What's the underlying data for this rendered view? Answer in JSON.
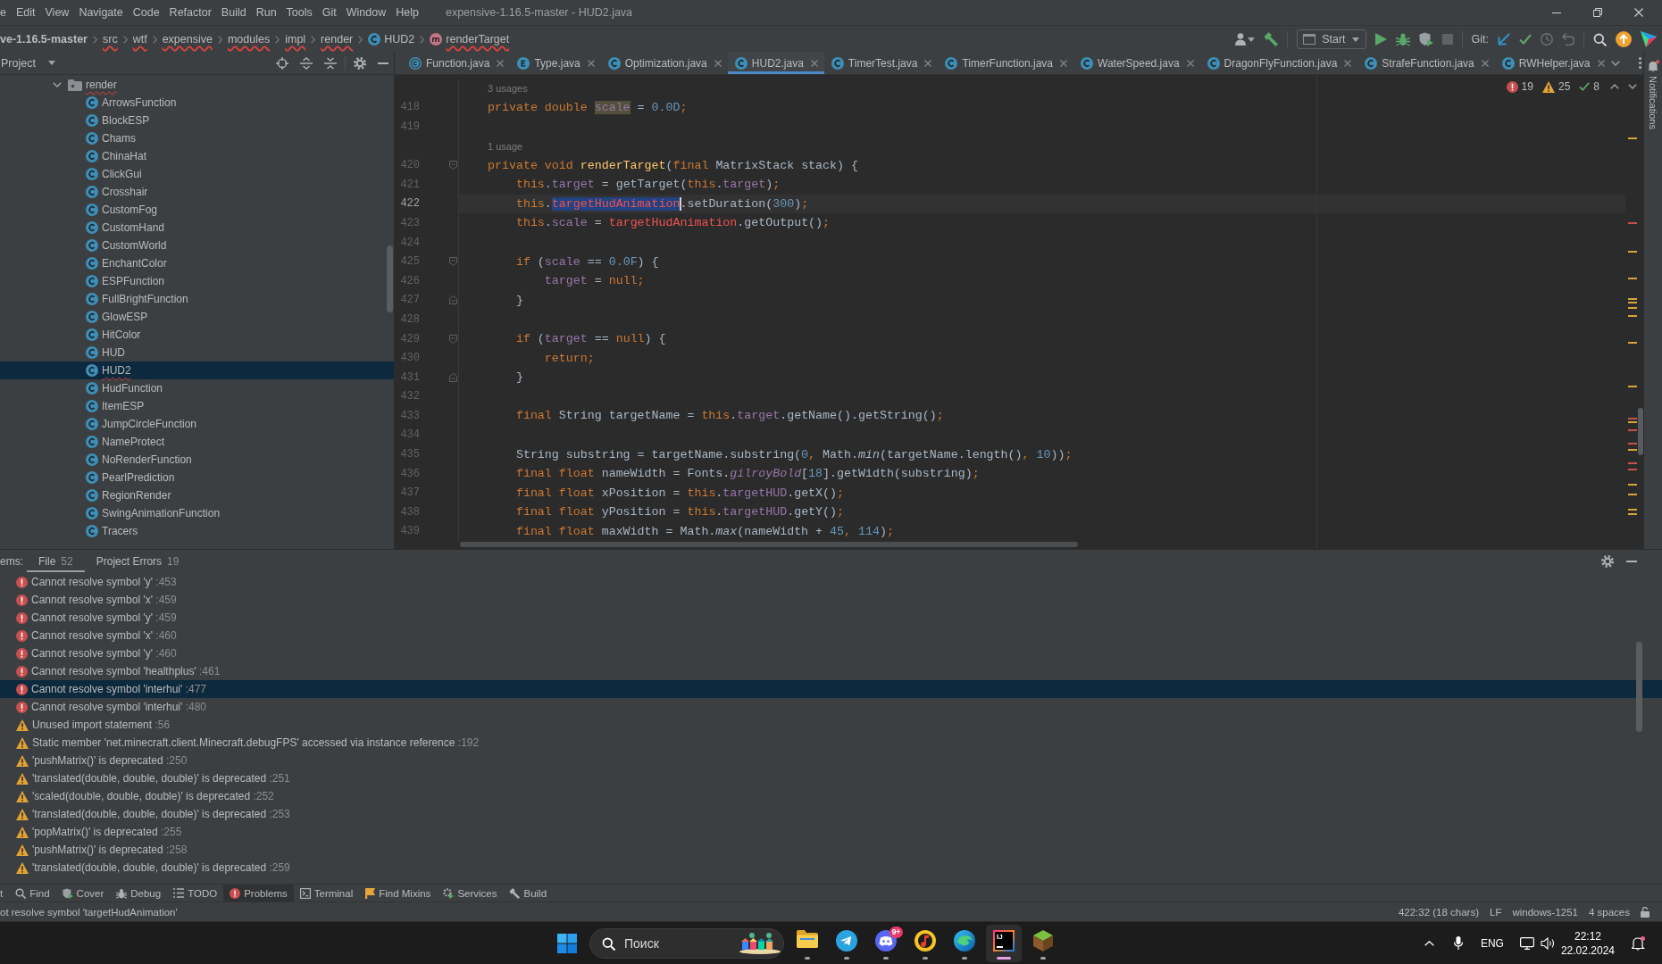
{
  "menu_bar": {
    "items": [
      "e",
      "Edit",
      "View",
      "Navigate",
      "Code",
      "Refactor",
      "Build",
      "Run",
      "Tools",
      "Git",
      "Window",
      "Help"
    ],
    "title": "expensive-1.16.5-master - HUD2.java"
  },
  "navigation_bar": {
    "breadcrumbs": [
      {
        "label": "ve-1.16.5-master",
        "kind": "project",
        "has_error": false
      },
      {
        "label": "src",
        "kind": "folder",
        "has_error": true
      },
      {
        "label": "wtf",
        "kind": "folder",
        "has_error": true
      },
      {
        "label": "expensive",
        "kind": "folder",
        "has_error": true
      },
      {
        "label": "modules",
        "kind": "folder",
        "has_error": true
      },
      {
        "label": "impl",
        "kind": "folder",
        "has_error": true
      },
      {
        "label": "render",
        "kind": "folder",
        "has_error": true
      },
      {
        "label": "HUD2",
        "kind": "class",
        "has_error": false
      },
      {
        "label": "renderTarget",
        "kind": "method",
        "has_error": true
      }
    ],
    "run_configuration": "Start",
    "vcs_label": "Git:"
  },
  "project_panel": {
    "title": "Project",
    "tree": [
      {
        "label": "render",
        "kind": "folder",
        "expanded": true,
        "selected": false,
        "has_error": true,
        "children": [
          {
            "label": "ArrowsFunction",
            "kind": "class",
            "selected": false,
            "has_error": false
          },
          {
            "label": "BlockESP",
            "kind": "class",
            "selected": false,
            "has_error": false
          },
          {
            "label": "Chams",
            "kind": "class",
            "selected": false,
            "has_error": false
          },
          {
            "label": "ChinaHat",
            "kind": "class",
            "selected": false,
            "has_error": false
          },
          {
            "label": "ClickGui",
            "kind": "class",
            "selected": false,
            "has_error": false
          },
          {
            "label": "Crosshair",
            "kind": "class",
            "selected": false,
            "has_error": false
          },
          {
            "label": "CustomFog",
            "kind": "class",
            "selected": false,
            "has_error": false
          },
          {
            "label": "CustomHand",
            "kind": "class",
            "selected": false,
            "has_error": false
          },
          {
            "label": "CustomWorld",
            "kind": "class",
            "selected": false,
            "has_error": false
          },
          {
            "label": "EnchantColor",
            "kind": "class",
            "selected": false,
            "has_error": false
          },
          {
            "label": "ESPFunction",
            "kind": "class",
            "selected": false,
            "has_error": false
          },
          {
            "label": "FullBrightFunction",
            "kind": "class",
            "selected": false,
            "has_error": false
          },
          {
            "label": "GlowESP",
            "kind": "class",
            "selected": false,
            "has_error": false
          },
          {
            "label": "HitColor",
            "kind": "class",
            "selected": false,
            "has_error": false
          },
          {
            "label": "HUD",
            "kind": "class",
            "selected": false,
            "has_error": false
          },
          {
            "label": "HUD2",
            "kind": "class",
            "selected": true,
            "has_error": true
          },
          {
            "label": "HudFunction",
            "kind": "class",
            "selected": false,
            "has_error": false
          },
          {
            "label": "ItemESP",
            "kind": "class",
            "selected": false,
            "has_error": false
          },
          {
            "label": "JumpCircleFunction",
            "kind": "class",
            "selected": false,
            "has_error": false
          },
          {
            "label": "NameProtect",
            "kind": "class",
            "selected": false,
            "has_error": false
          },
          {
            "label": "NoRenderFunction",
            "kind": "class",
            "selected": false,
            "has_error": false
          },
          {
            "label": "PearlPrediction",
            "kind": "class",
            "selected": false,
            "has_error": false
          },
          {
            "label": "RegionRender",
            "kind": "class",
            "selected": false,
            "has_error": false
          },
          {
            "label": "SwingAnimationFunction",
            "kind": "class",
            "selected": false,
            "has_error": false
          },
          {
            "label": "Tracers",
            "kind": "class",
            "selected": false,
            "has_error": false
          }
        ]
      }
    ]
  },
  "editor_tabs": [
    {
      "label": "Function.java",
      "kind": "abstract-class",
      "selected": false
    },
    {
      "label": "Type.java",
      "kind": "enum",
      "selected": false
    },
    {
      "label": "Optimization.java",
      "kind": "class",
      "selected": false
    },
    {
      "label": "HUD2.java",
      "kind": "class",
      "selected": true
    },
    {
      "label": "TimerTest.java",
      "kind": "class",
      "selected": false
    },
    {
      "label": "TimerFunction.java",
      "kind": "class",
      "selected": false
    },
    {
      "label": "WaterSpeed.java",
      "kind": "class",
      "selected": false
    },
    {
      "label": "DragonFlyFunction.java",
      "kind": "class",
      "selected": false
    },
    {
      "label": "StrafeFunction.java",
      "kind": "class",
      "selected": false
    },
    {
      "label": "RWHelper.java",
      "kind": "class",
      "selected": false
    }
  ],
  "editor": {
    "inspections": {
      "errors": "19",
      "warnings": "25",
      "weak_warnings": "8"
    },
    "lines": [
      {
        "kind": "hint",
        "text": "3 usages"
      },
      {
        "kind": "code",
        "number": "418",
        "current": false,
        "tokens": [
          {
            "text": "private double ",
            "kind": "keyword"
          },
          {
            "text": "scale",
            "kind": "field",
            "highlighted": true
          },
          {
            "text": " = ",
            "kind": "plain"
          },
          {
            "text": "0.0D",
            "kind": "number"
          },
          {
            "text": ";",
            "kind": "keyword"
          }
        ]
      },
      {
        "kind": "code",
        "number": "419",
        "current": false
      },
      {
        "kind": "hint",
        "text": "1 usage"
      },
      {
        "kind": "fold-start",
        "number": "420",
        "current": false,
        "tokens": [
          {
            "text": "private void ",
            "kind": "keyword"
          },
          {
            "text": "renderTarget",
            "kind": "declaration"
          },
          {
            "text": "(",
            "kind": "plain"
          },
          {
            "text": "final ",
            "kind": "keyword"
          },
          {
            "text": "MatrixStack stack) {",
            "kind": "plain"
          }
        ]
      },
      {
        "kind": "code",
        "number": "421",
        "current": false,
        "tokens": [
          {
            "text": "    this",
            "kind": "keyword"
          },
          {
            "text": ".",
            "kind": "plain"
          },
          {
            "text": "target",
            "kind": "field"
          },
          {
            "text": " = getTarget(",
            "kind": "plain"
          },
          {
            "text": "this",
            "kind": "keyword"
          },
          {
            "text": ".",
            "kind": "plain"
          },
          {
            "text": "target",
            "kind": "field"
          },
          {
            "text": ")",
            "kind": "plain"
          },
          {
            "text": ";",
            "kind": "keyword"
          }
        ]
      },
      {
        "kind": "code",
        "number": "422",
        "current": true,
        "tokens": [
          {
            "text": "    this",
            "kind": "keyword"
          },
          {
            "text": ".",
            "kind": "plain"
          },
          {
            "text": "targetHudAnimation",
            "kind": "unresolved",
            "selected": true
          },
          {
            "text": ".setDuration(",
            "kind": "plain"
          },
          {
            "text": "300",
            "kind": "number"
          },
          {
            "text": ")",
            "kind": "plain"
          },
          {
            "text": ";",
            "kind": "keyword"
          }
        ]
      },
      {
        "kind": "code",
        "number": "423",
        "current": false,
        "tokens": [
          {
            "text": "    this",
            "kind": "keyword"
          },
          {
            "text": ".",
            "kind": "plain"
          },
          {
            "text": "scale",
            "kind": "field"
          },
          {
            "text": " = ",
            "kind": "plain"
          },
          {
            "text": "targetHudAnimation",
            "kind": "unresolved"
          },
          {
            "text": ".getOutput()",
            "kind": "plain"
          },
          {
            "text": ";",
            "kind": "keyword"
          }
        ]
      },
      {
        "kind": "code",
        "number": "424",
        "current": false
      },
      {
        "kind": "fold-start",
        "number": "425",
        "current": false,
        "tokens": [
          {
            "text": "    if",
            "kind": "keyword"
          },
          {
            "text": " (",
            "kind": "plain"
          },
          {
            "text": "scale",
            "kind": "field"
          },
          {
            "text": " == ",
            "kind": "plain"
          },
          {
            "text": "0.0F",
            "kind": "number"
          },
          {
            "text": ") {",
            "kind": "plain"
          }
        ]
      },
      {
        "kind": "code",
        "number": "426",
        "current": false,
        "tokens": [
          {
            "text": "        target",
            "kind": "field"
          },
          {
            "text": " = ",
            "kind": "plain"
          },
          {
            "text": "null;",
            "kind": "keyword"
          }
        ]
      },
      {
        "kind": "fold-end",
        "number": "427",
        "current": false,
        "tokens": [
          {
            "text": "    }",
            "kind": "plain"
          }
        ]
      },
      {
        "kind": "code",
        "number": "428",
        "current": false
      },
      {
        "kind": "fold-start",
        "number": "429",
        "current": false,
        "tokens": [
          {
            "text": "    if",
            "kind": "keyword"
          },
          {
            "text": " (",
            "kind": "plain"
          },
          {
            "text": "target",
            "kind": "field"
          },
          {
            "text": " == ",
            "kind": "plain"
          },
          {
            "text": "null",
            "kind": "keyword"
          },
          {
            "text": ") {",
            "kind": "plain"
          }
        ]
      },
      {
        "kind": "code",
        "number": "430",
        "current": false,
        "tokens": [
          {
            "text": "        return;",
            "kind": "keyword"
          }
        ]
      },
      {
        "kind": "fold-end",
        "number": "431",
        "current": false,
        "tokens": [
          {
            "text": "    }",
            "kind": "plain"
          }
        ]
      },
      {
        "kind": "code",
        "number": "432",
        "current": false
      },
      {
        "kind": "code",
        "number": "433",
        "current": false,
        "tokens": [
          {
            "text": "    final ",
            "kind": "keyword"
          },
          {
            "text": "String targetName = ",
            "kind": "plain"
          },
          {
            "text": "this",
            "kind": "keyword"
          },
          {
            "text": ".",
            "kind": "plain"
          },
          {
            "text": "target",
            "kind": "field"
          },
          {
            "text": ".getName().getString()",
            "kind": "plain"
          },
          {
            "text": ";",
            "kind": "keyword"
          }
        ]
      },
      {
        "kind": "code",
        "number": "434",
        "current": false
      },
      {
        "kind": "code",
        "number": "435",
        "current": false,
        "tokens": [
          {
            "text": "    String substring = targetName.substring(",
            "kind": "plain"
          },
          {
            "text": "0",
            "kind": "number"
          },
          {
            "text": ", ",
            "kind": "keyword"
          },
          {
            "text": "Math.",
            "kind": "plain"
          },
          {
            "text": "min",
            "kind": "static-method"
          },
          {
            "text": "(targetName.length()",
            "kind": "plain"
          },
          {
            "text": ", ",
            "kind": "keyword"
          },
          {
            "text": "10",
            "kind": "number"
          },
          {
            "text": "))",
            "kind": "plain"
          },
          {
            "text": ";",
            "kind": "keyword"
          }
        ]
      },
      {
        "kind": "code",
        "number": "436",
        "current": false,
        "tokens": [
          {
            "text": "    final float ",
            "kind": "keyword"
          },
          {
            "text": "nameWidth = Fonts.",
            "kind": "plain"
          },
          {
            "text": "gilroyBold",
            "kind": "static-field"
          },
          {
            "text": "[",
            "kind": "plain"
          },
          {
            "text": "18",
            "kind": "number"
          },
          {
            "text": "].getWidth(substring)",
            "kind": "plain"
          },
          {
            "text": ";",
            "kind": "keyword"
          }
        ]
      },
      {
        "kind": "code",
        "number": "437",
        "current": false,
        "tokens": [
          {
            "text": "    final float ",
            "kind": "keyword"
          },
          {
            "text": "xPosition = ",
            "kind": "plain"
          },
          {
            "text": "this",
            "kind": "keyword"
          },
          {
            "text": ".",
            "kind": "plain"
          },
          {
            "text": "targetHUD",
            "kind": "field"
          },
          {
            "text": ".getX()",
            "kind": "plain"
          },
          {
            "text": ";",
            "kind": "keyword"
          }
        ]
      },
      {
        "kind": "code",
        "number": "438",
        "current": false,
        "tokens": [
          {
            "text": "    final float ",
            "kind": "keyword"
          },
          {
            "text": "yPosition = ",
            "kind": "plain"
          },
          {
            "text": "this",
            "kind": "keyword"
          },
          {
            "text": ".",
            "kind": "plain"
          },
          {
            "text": "targetHUD",
            "kind": "field"
          },
          {
            "text": ".getY()",
            "kind": "plain"
          },
          {
            "text": ";",
            "kind": "keyword"
          }
        ]
      },
      {
        "kind": "code",
        "number": "439",
        "current": false,
        "tokens": [
          {
            "text": "    final float ",
            "kind": "keyword"
          },
          {
            "text": "maxWidth = Math.",
            "kind": "plain"
          },
          {
            "text": "max",
            "kind": "static-method"
          },
          {
            "text": "(nameWidth + ",
            "kind": "plain"
          },
          {
            "text": "45",
            "kind": "number"
          },
          {
            "text": ", ",
            "kind": "keyword"
          },
          {
            "text": "114",
            "kind": "number"
          },
          {
            "text": ")",
            "kind": "plain"
          },
          {
            "text": ";",
            "kind": "keyword"
          }
        ]
      }
    ]
  },
  "notifications_strip": {
    "label": "Notifications"
  },
  "problems_panel": {
    "title": "ems:",
    "tabs": [
      {
        "label": "File",
        "count": "52",
        "selected": true
      },
      {
        "label": "Project Errors",
        "count": "19",
        "selected": false
      }
    ],
    "rows": [
      {
        "kind": "error",
        "message": "Cannot resolve symbol 'y'",
        "line": ":453",
        "selected": false
      },
      {
        "kind": "error",
        "message": "Cannot resolve symbol 'x'",
        "line": ":459",
        "selected": false
      },
      {
        "kind": "error",
        "message": "Cannot resolve symbol 'y'",
        "line": ":459",
        "selected": false
      },
      {
        "kind": "error",
        "message": "Cannot resolve symbol 'x'",
        "line": ":460",
        "selected": false
      },
      {
        "kind": "error",
        "message": "Cannot resolve symbol 'y'",
        "line": ":460",
        "selected": false
      },
      {
        "kind": "error",
        "message": "Cannot resolve symbol 'healthplus'",
        "line": ":461",
        "selected": false
      },
      {
        "kind": "error",
        "message": "Cannot resolve symbol 'interhui'",
        "line": ":477",
        "selected": true
      },
      {
        "kind": "error",
        "message": "Cannot resolve symbol 'interhui'",
        "line": ":480",
        "selected": false
      },
      {
        "kind": "warning",
        "message": "Unused import statement",
        "line": ":56",
        "selected": false
      },
      {
        "kind": "warning",
        "message": "Static member 'net.minecraft.client.Minecraft.debugFPS' accessed via instance reference",
        "line": ":192",
        "selected": false
      },
      {
        "kind": "warning",
        "message": "'pushMatrix()' is deprecated",
        "line": ":250",
        "selected": false
      },
      {
        "kind": "warning",
        "message": "'translated(double, double, double)' is deprecated",
        "line": ":251",
        "selected": false
      },
      {
        "kind": "warning",
        "message": "'scaled(double, double, double)' is deprecated",
        "line": ":252",
        "selected": false
      },
      {
        "kind": "warning",
        "message": "'translated(double, double, double)' is deprecated",
        "line": ":253",
        "selected": false
      },
      {
        "kind": "warning",
        "message": "'popMatrix()' is deprecated",
        "line": ":255",
        "selected": false
      },
      {
        "kind": "warning",
        "message": "'pushMatrix()' is deprecated",
        "line": ":258",
        "selected": false
      },
      {
        "kind": "warning",
        "message": "'translated(double, double, double)' is deprecated",
        "line": ":259",
        "selected": false
      }
    ]
  },
  "tool_window_bar": [
    {
      "label": "t",
      "kind": "plain",
      "selected": false
    },
    {
      "label": "Find",
      "kind": "find",
      "selected": false
    },
    {
      "label": "Cover",
      "kind": "coverage",
      "selected": false
    },
    {
      "label": "Debug",
      "kind": "debug",
      "selected": false
    },
    {
      "label": "TODO",
      "kind": "todo",
      "selected": false
    },
    {
      "label": "Problems",
      "kind": "problems",
      "selected": true
    },
    {
      "label": "Terminal",
      "kind": "terminal",
      "selected": false
    },
    {
      "label": "Find Mixins",
      "kind": "mixins",
      "selected": false
    },
    {
      "label": "Services",
      "kind": "services",
      "selected": false
    },
    {
      "label": "Build",
      "kind": "build",
      "selected": false
    }
  ],
  "status_bar": {
    "message": "ot resolve symbol 'targetHudAnimation'",
    "caret": "422:32 (18 chars)",
    "line_separator": "LF",
    "encoding": "windows-1251",
    "indent": "4 spaces"
  },
  "taskbar": {
    "search": {
      "placeholder": "Поиск"
    },
    "apps": [
      {
        "kind": "files",
        "running": true,
        "selected": false
      },
      {
        "kind": "messenger",
        "running": true,
        "selected": false
      },
      {
        "kind": "chat",
        "badge": "9+",
        "running": true,
        "selected": false
      },
      {
        "kind": "music",
        "running": true,
        "selected": false
      },
      {
        "kind": "browser",
        "running": true,
        "selected": false
      },
      {
        "kind": "ide",
        "glyph": "IJ",
        "running": true,
        "selected": true
      },
      {
        "kind": "game",
        "running": true,
        "selected": false
      }
    ],
    "language": "ENG",
    "time": "22:12",
    "date": "22.02.2024"
  }
}
